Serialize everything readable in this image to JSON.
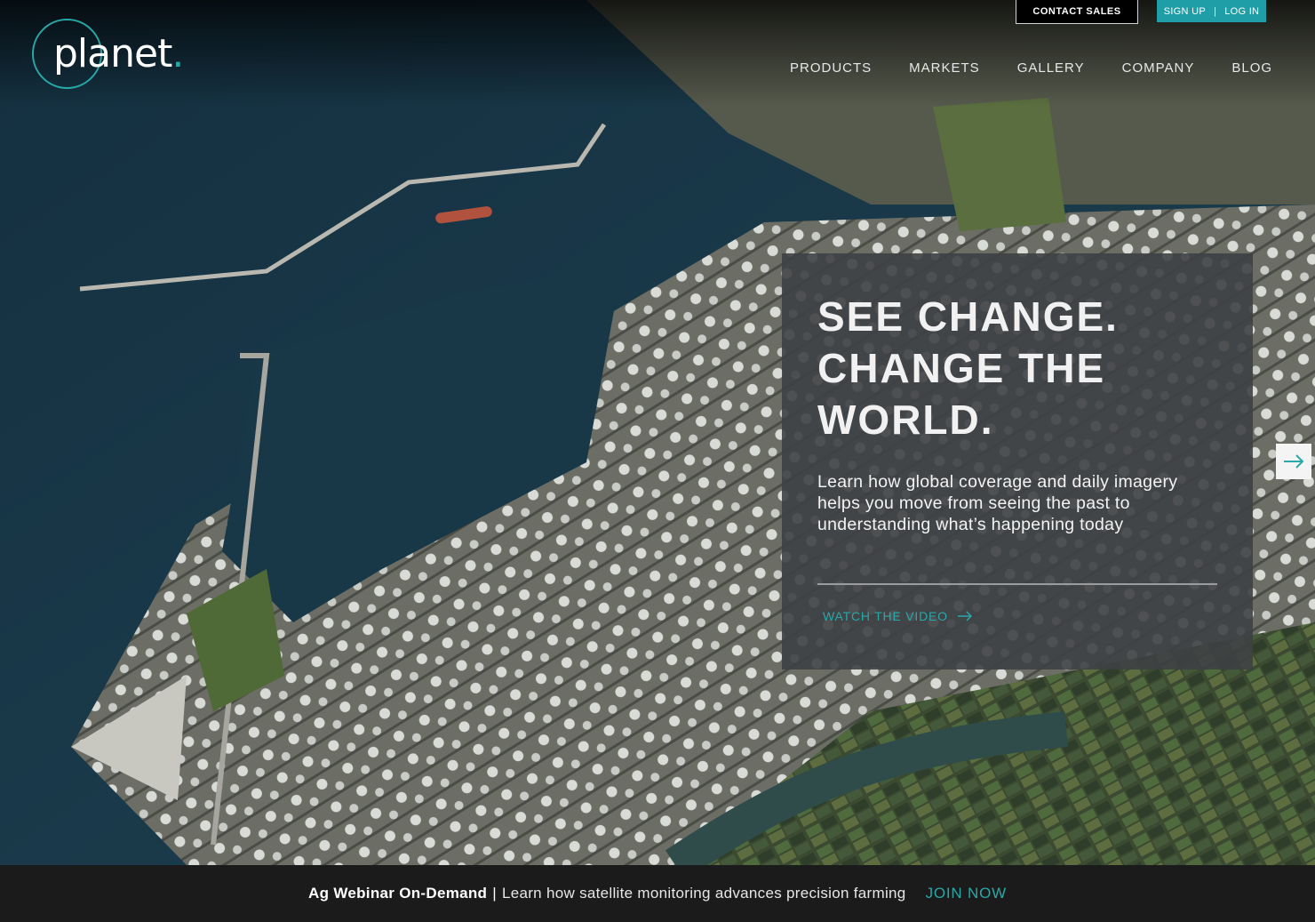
{
  "brand": {
    "logo_text": "planet",
    "logo_dot": ".",
    "accent": "#29a8a8"
  },
  "top_actions": {
    "contact_sales": "CONTACT SALES",
    "sign_up": "SIGN UP",
    "separator": "|",
    "log_in": "LOG IN"
  },
  "nav": {
    "items": [
      {
        "label": "PRODUCTS"
      },
      {
        "label": "MARKETS"
      },
      {
        "label": "GALLERY"
      },
      {
        "label": "COMPANY"
      },
      {
        "label": "BLOG"
      }
    ]
  },
  "hero": {
    "headline_line1": "SEE CHANGE.",
    "headline_line2": "CHANGE THE",
    "headline_line3": "WORLD.",
    "subtext": "Learn how global coverage and daily imagery helps you move from seeing the past to understanding what’s happening today",
    "cta": "WATCH THE VIDEO",
    "cta_icon": "arrow-right-icon",
    "next_icon": "arrow-right-icon"
  },
  "banner": {
    "title": "Ag Webinar On-Demand",
    "separator": "|",
    "description": "Learn how satellite monitoring advances precision farming",
    "cta": "JOIN NOW"
  }
}
